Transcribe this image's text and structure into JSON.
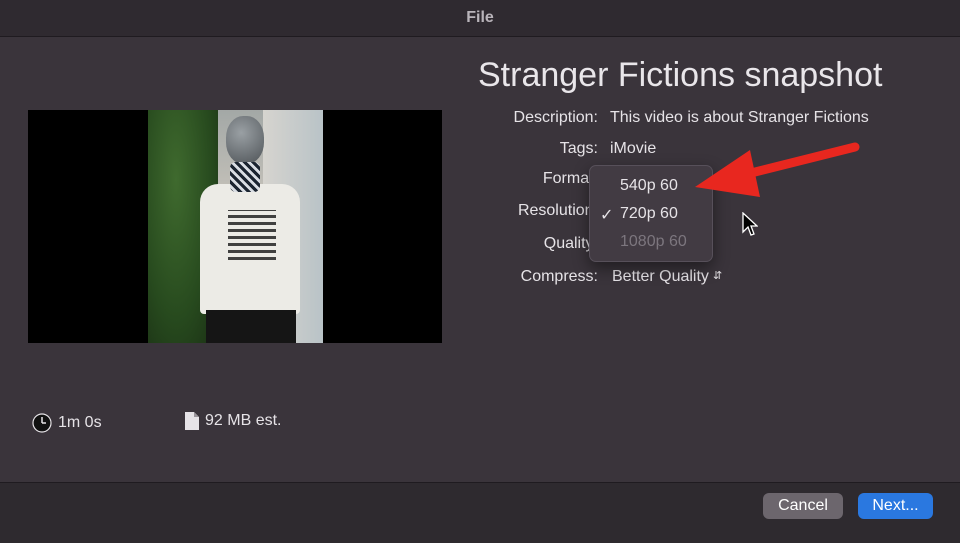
{
  "window": {
    "title": "File"
  },
  "heading": "Stranger Fictions snapshot",
  "fields": {
    "description": {
      "label": "Description:",
      "value": "This video is about Stranger Fictions"
    },
    "tags": {
      "label": "Tags:",
      "value": "iMovie"
    },
    "format": {
      "label": "Format:"
    },
    "resolution": {
      "label": "Resolution:"
    },
    "quality": {
      "label": "Quality:"
    },
    "compress": {
      "label": "Compress:",
      "value": "Better Quality"
    }
  },
  "resolution_menu": {
    "items": [
      {
        "label": "540p 60",
        "checked": false,
        "enabled": true
      },
      {
        "label": "720p 60",
        "checked": true,
        "enabled": true
      },
      {
        "label": "1080p 60",
        "checked": false,
        "enabled": false
      }
    ],
    "check_glyph": "✓"
  },
  "info": {
    "duration": "1m 0s",
    "size": "92 MB est."
  },
  "buttons": {
    "cancel": "Cancel",
    "next": "Next..."
  },
  "icons": {
    "duration": "clock-icon",
    "size": "document-icon",
    "stepper": "up-down-chevron-icon",
    "annotation": "red-arrow-icon",
    "pointer": "mouse-cursor-icon"
  },
  "colors": {
    "accent": "#2a78e0",
    "annotation_arrow": "#e8271f",
    "background": "#3a343b"
  }
}
